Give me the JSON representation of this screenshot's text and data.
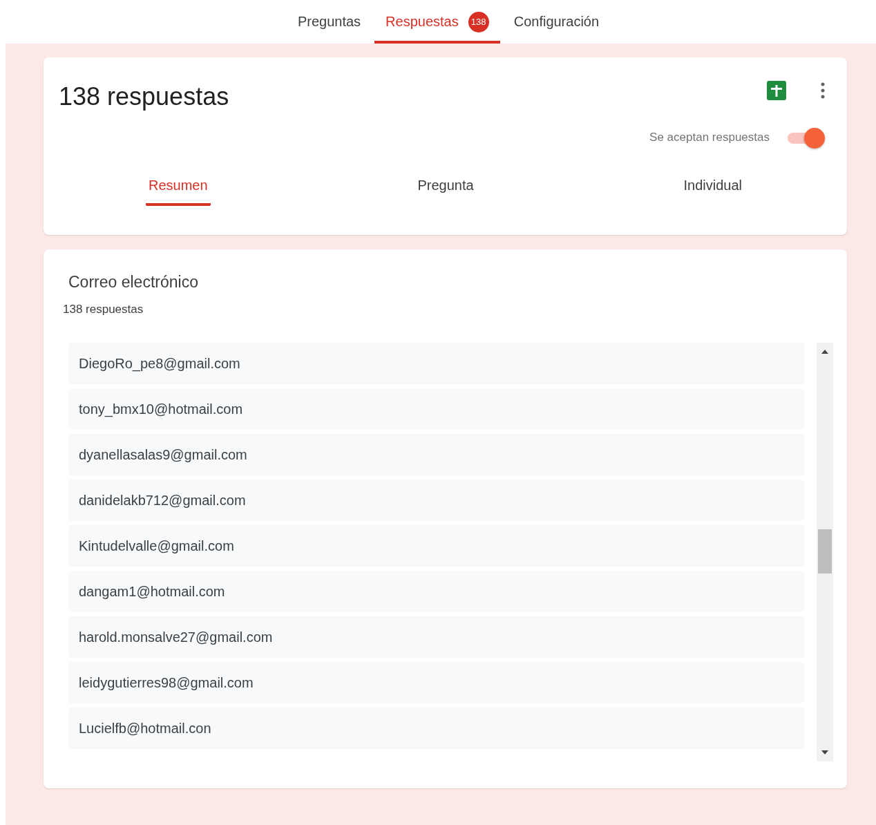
{
  "top_tabs": [
    {
      "label": "Preguntas",
      "selected": false
    },
    {
      "label": "Respuestas",
      "selected": true,
      "badge": "138"
    },
    {
      "label": "Configuración",
      "selected": false
    }
  ],
  "summary": {
    "title": "138 respuestas",
    "accepting": {
      "label": "Se aceptan respuestas",
      "on": true
    }
  },
  "view_tabs": [
    {
      "label": "Resumen",
      "selected": true
    },
    {
      "label": "Pregunta",
      "selected": false
    },
    {
      "label": "Individual",
      "selected": false
    }
  ],
  "question": {
    "title": "Correo electrónico",
    "count": "138 respuestas",
    "answers": [
      "DiegoRo_pe8@gmail.com",
      "tony_bmx10@hotmail.com",
      "dyanellasalas9@gmail.com",
      "danidelakb712@gmail.com",
      "Kintudelvalle@gmail.com",
      "dangam1@hotmail.com",
      "harold.monsalve27@gmail.com",
      "leidygutierres98@gmail.com",
      "Lucielfb@hotmail.con"
    ]
  }
}
